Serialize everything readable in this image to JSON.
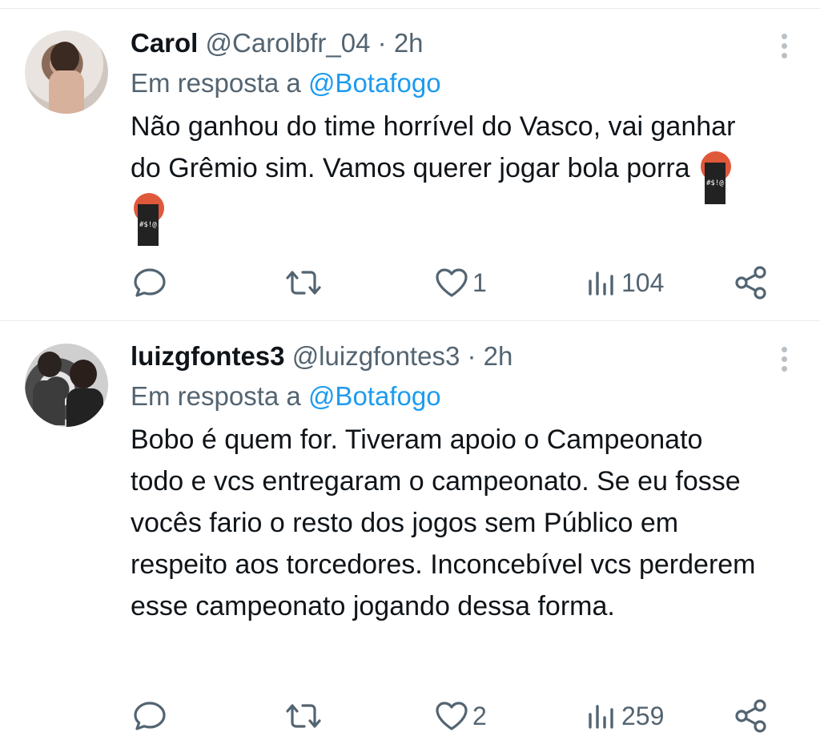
{
  "tweets": [
    {
      "name": "Carol",
      "handle": "@Carolbfr_04",
      "dot": "·",
      "time": "2h",
      "reply_prefix": "Em resposta a",
      "reply_to": "@Botafogo",
      "text": "Não ganhou do time horrível do Vasco, vai ganhar do Grêmio sim. Vamos querer jogar bola porra",
      "emojis": [
        "face-with-symbols-on-mouth",
        "face-with-symbols-on-mouth"
      ],
      "likes": "1",
      "views": "104",
      "icons": [
        "reply-icon",
        "retweet-icon",
        "heart-icon",
        "views-icon",
        "share-icon",
        "more-icon"
      ]
    },
    {
      "name": "luizgfontes3",
      "handle": "@luizgfontes3",
      "dot": "·",
      "time": "2h",
      "reply_prefix": "Em resposta a",
      "reply_to": "@Botafogo",
      "text": "Bobo é quem for. Tiveram apoio o Campeonato todo e vcs entregaram o campeonato. Se eu fosse vocês fario o resto dos jogos sem Público em respeito aos torcedores. Inconcebível vcs perderem esse campeonato jogando dessa forma.",
      "likes": "2",
      "views": "259",
      "icons": [
        "reply-icon",
        "retweet-icon",
        "heart-icon",
        "views-icon",
        "share-icon",
        "more-icon"
      ]
    }
  ],
  "colors": {
    "text": "#0f1419",
    "muted": "#536471",
    "link": "#1d9bf0",
    "divider": "#e6ecf0"
  }
}
